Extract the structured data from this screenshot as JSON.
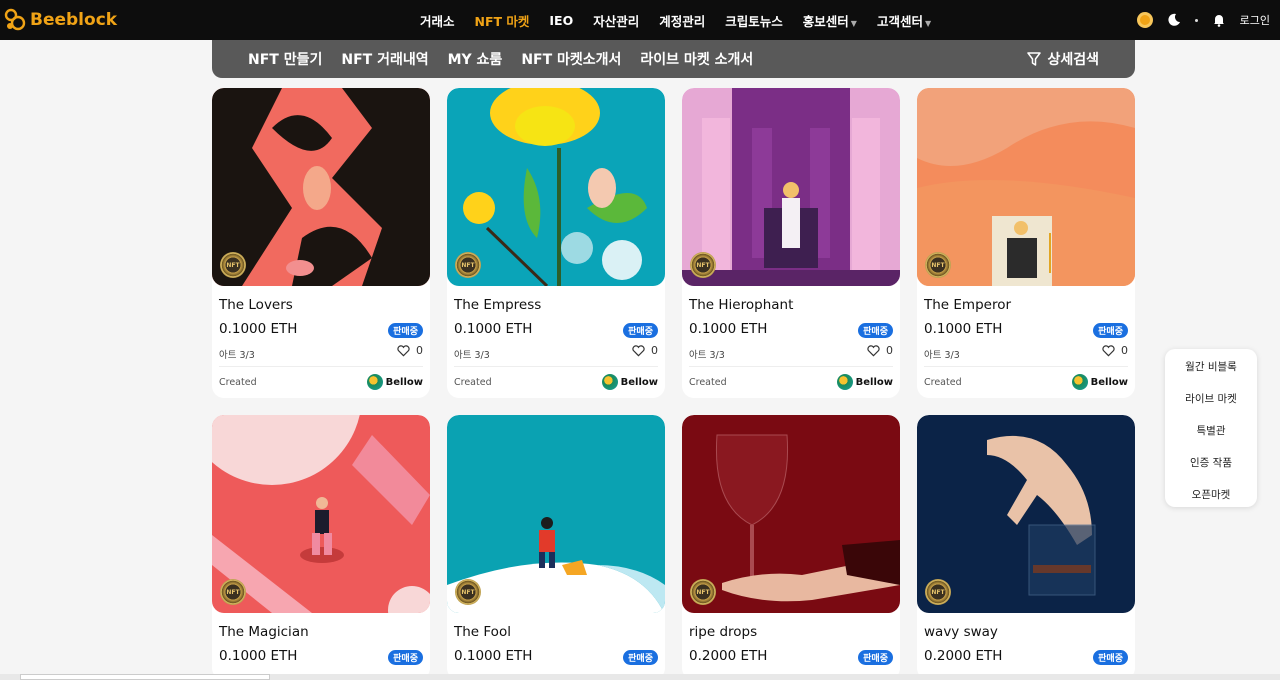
{
  "brand": {
    "name": "Beeblock"
  },
  "topnav": {
    "items": [
      {
        "label": "거래소",
        "active": false
      },
      {
        "label": "NFT 마켓",
        "active": true
      },
      {
        "label": "IEO",
        "active": false
      },
      {
        "label": "자산관리",
        "active": false
      },
      {
        "label": "계정관리",
        "active": false
      },
      {
        "label": "크립토뉴스",
        "active": false
      },
      {
        "label": "홍보센터",
        "active": false,
        "dropdown": true
      },
      {
        "label": "고객센터",
        "active": false,
        "dropdown": true
      }
    ],
    "login_label": "로그인",
    "accent_color": "#f0a316"
  },
  "subnav": {
    "items": [
      "NFT 만들기",
      "NFT 거래내역",
      "MY 쇼룸",
      "NFT 마켓소개서",
      "라이브 마켓 소개서"
    ],
    "filter_label": "상세검색"
  },
  "cards": [
    {
      "title": "The Lovers",
      "price": "0.1000 ETH",
      "status": "판매중",
      "edition": "아트 3/3",
      "likes": "0",
      "created_label": "Created",
      "owner": "Bellow"
    },
    {
      "title": "The Empress",
      "price": "0.1000 ETH",
      "status": "판매중",
      "edition": "아트 3/3",
      "likes": "0",
      "created_label": "Created",
      "owner": "Bellow"
    },
    {
      "title": "The Hierophant",
      "price": "0.1000 ETH",
      "status": "판매중",
      "edition": "아트 3/3",
      "likes": "0",
      "created_label": "Created",
      "owner": "Bellow"
    },
    {
      "title": "The Emperor",
      "price": "0.1000 ETH",
      "status": "판매중",
      "edition": "아트 3/3",
      "likes": "0",
      "created_label": "Created",
      "owner": "Bellow"
    },
    {
      "title": "The Magician",
      "price": "0.1000 ETH",
      "status": "판매중"
    },
    {
      "title": "The Fool",
      "price": "0.1000 ETH",
      "status": "판매중"
    },
    {
      "title": "ripe drops",
      "price": "0.2000 ETH",
      "status": "판매중"
    },
    {
      "title": "wavy sway",
      "price": "0.2000 ETH",
      "status": "판매중"
    }
  ],
  "nft_badge": "NFT",
  "side_menu": [
    "월간 비블록",
    "라이브 마켓",
    "특별관",
    "인증 작품",
    "오픈마켓"
  ]
}
